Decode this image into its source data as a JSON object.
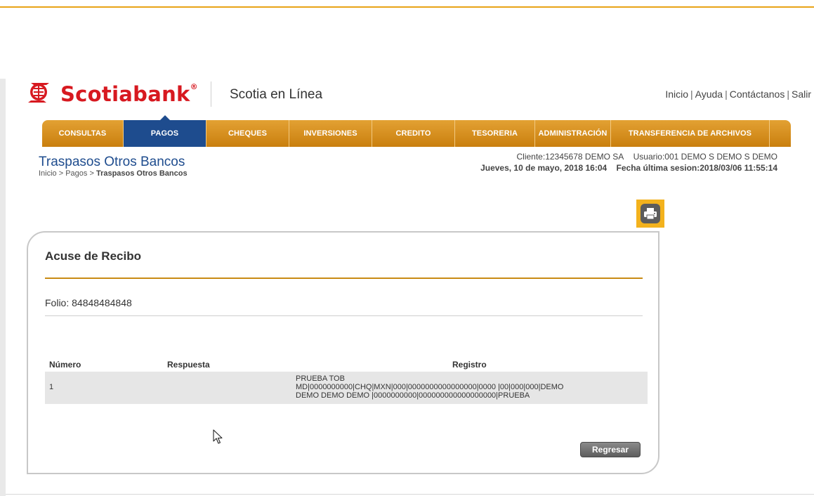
{
  "header": {
    "brand": "Scotiabank",
    "brand_mark": "®",
    "product": "Scotia en Línea",
    "links": [
      "Inicio",
      "Ayuda",
      "Contáctanos",
      "Salir"
    ]
  },
  "nav": {
    "items": [
      {
        "label": "CONSULTAS"
      },
      {
        "label": "PAGOS"
      },
      {
        "label": "CHEQUES"
      },
      {
        "label": "INVERSIONES"
      },
      {
        "label": "CREDITO"
      },
      {
        "label": "TESORERIA"
      },
      {
        "label": "ADMINISTRACIÓN"
      },
      {
        "label": "TRANSFERENCIA DE ARCHIVOS"
      }
    ],
    "active": "PAGOS"
  },
  "page": {
    "title": "Traspasos Otros Bancos",
    "breadcrumb_prefix": "Inicio > Pagos > ",
    "breadcrumb_current": "Traspasos Otros Bancos",
    "client": "Cliente:12345678  DEMO SA",
    "user": "Usuario:001 DEMO S DEMO S DEMO",
    "date": "Jueves, 10 de mayo, 2018 16:04",
    "last_session": "Fecha última sesion:2018/03/06 11:55:14"
  },
  "receipt": {
    "title": "Acuse de Recibo",
    "folio_label": "Folio:",
    "folio_value": "84848484848",
    "columns": [
      "Número",
      "Respuesta",
      "Registro"
    ],
    "rows": [
      {
        "numero": "1",
        "respuesta": "",
        "registro_lines": [
          "PRUEBA TOB",
          "MD|0000000000|CHQ|MXN|000|0000000000000000|0000 |00|000|000|DEMO",
          "DEMO DEMO DEMO |0000000000|000000000000000000|PRUEBA"
        ]
      }
    ],
    "back_button": "Regresar"
  },
  "colors": {
    "accent": "#e8a317",
    "nav_orange": "#d68f1a",
    "nav_active": "#1e4c8e",
    "brand_red": "#d71920",
    "title_blue": "#1e4c8e"
  },
  "icons": {
    "print": "printer-icon",
    "logo": "scotiabank-logo-icon",
    "cursor": "mouse-cursor-icon"
  }
}
